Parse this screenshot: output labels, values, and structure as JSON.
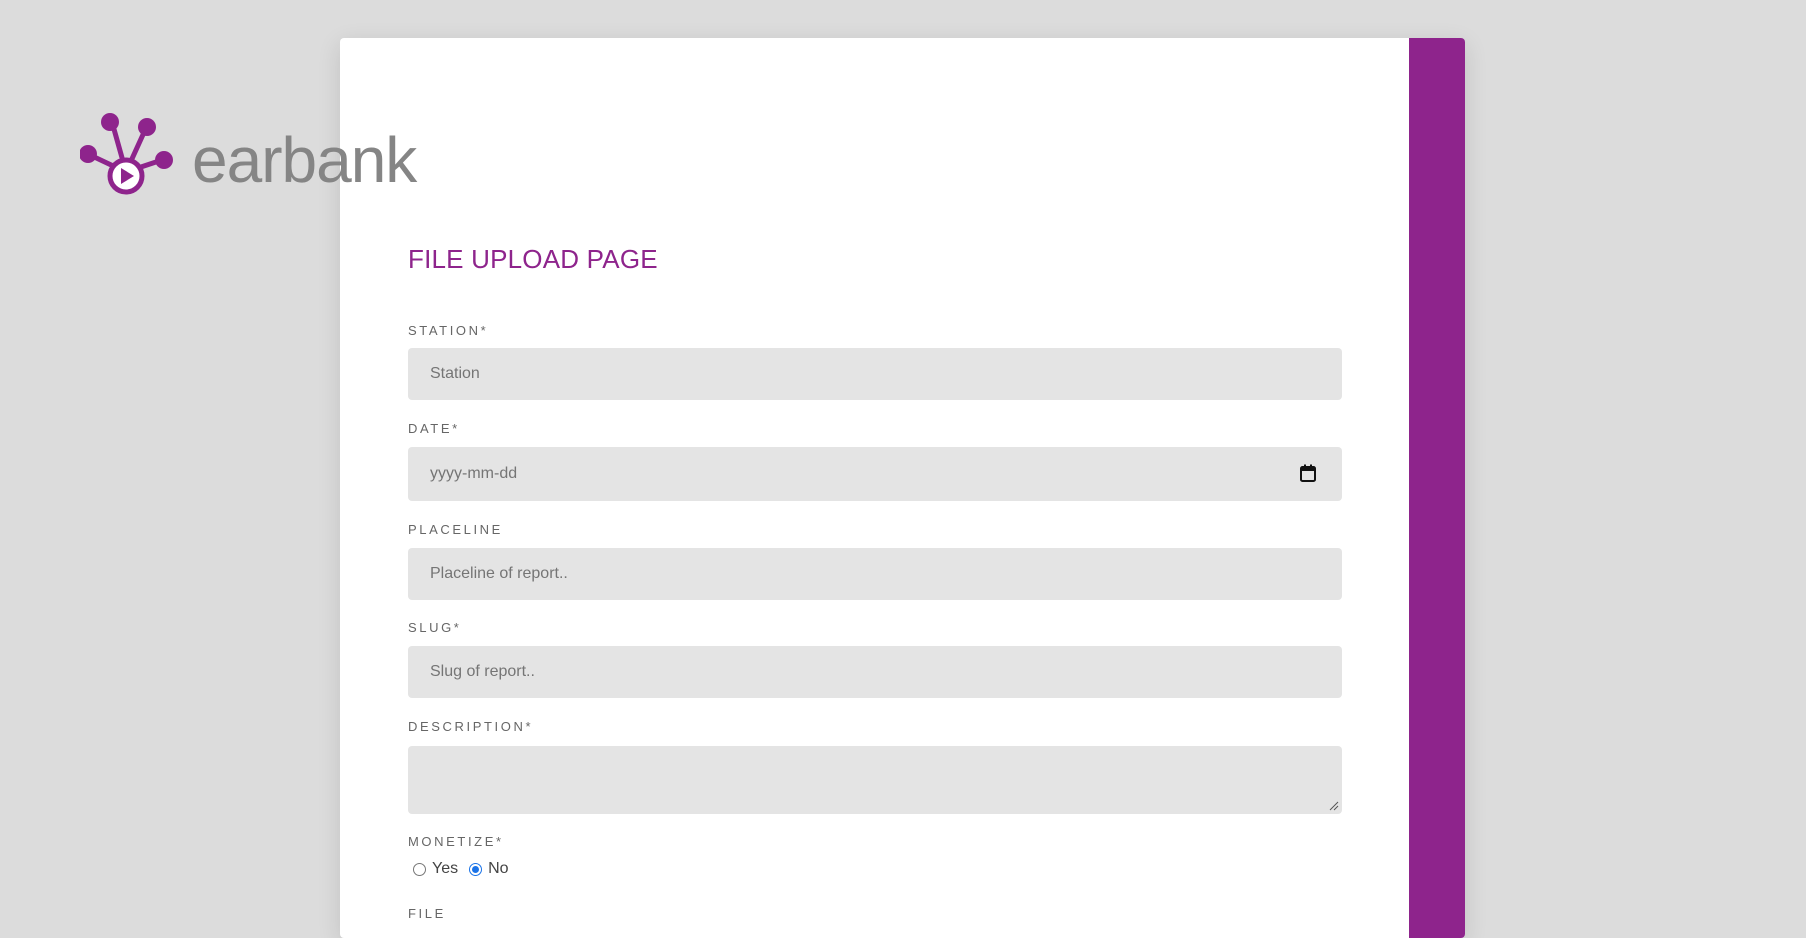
{
  "brand": {
    "name": "earbank",
    "accent_color": "#8e248c"
  },
  "page": {
    "title": "FILE UPLOAD PAGE"
  },
  "form": {
    "station": {
      "label": "STATION*",
      "placeholder": "Station"
    },
    "date": {
      "label": "DATE*",
      "placeholder": "yyyy-mm-dd",
      "icon": "calendar-icon"
    },
    "placeline": {
      "label": "PLACELINE",
      "placeholder": "Placeline of report.."
    },
    "slug": {
      "label": "SLUG*",
      "placeholder": "Slug of report.."
    },
    "description": {
      "label": "DESCRIPTION*",
      "value": ""
    },
    "monetize": {
      "label": "MONETIZE*",
      "options": [
        {
          "label": "Yes",
          "selected": false
        },
        {
          "label": "No",
          "selected": true
        }
      ]
    },
    "file": {
      "label": "FILE"
    }
  }
}
